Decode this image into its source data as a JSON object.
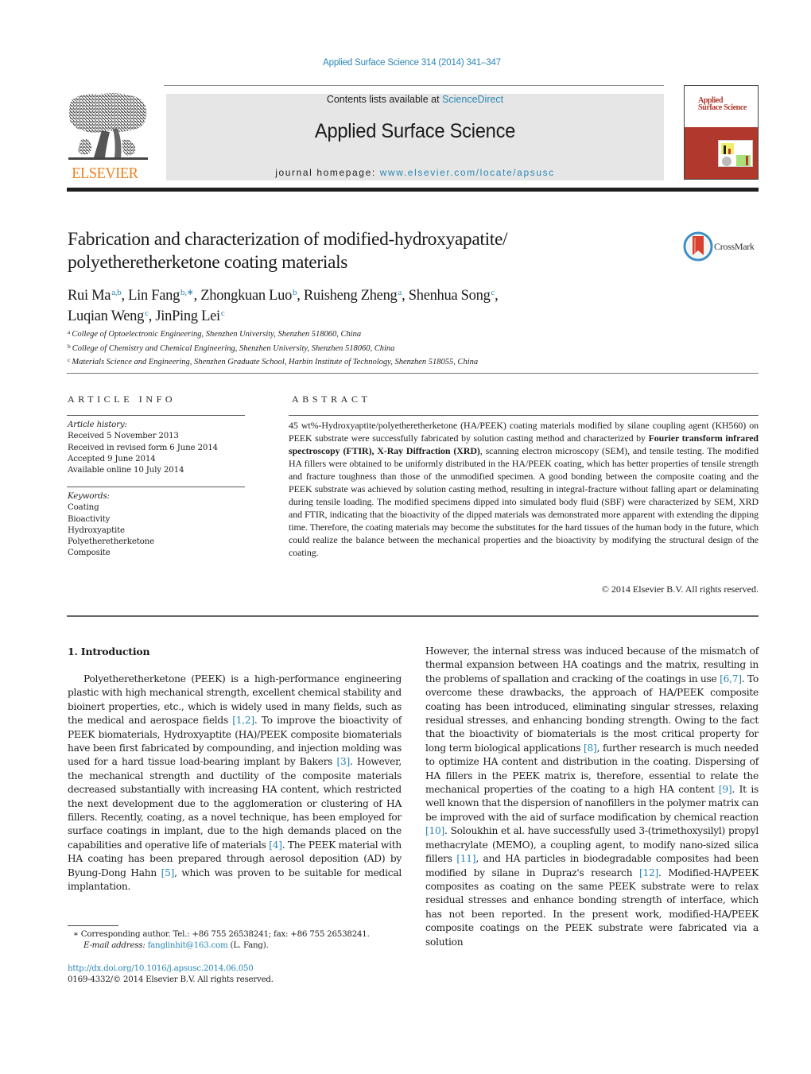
{
  "header": {
    "journal_ref": "Applied Surface Science 314 (2014) 341–347",
    "contents_prefix": "Contents lists available at ",
    "contents_link": "ScienceDirect",
    "journal_title": "Applied Surface Science",
    "homepage_prefix": "journal homepage: ",
    "homepage_link": "www.elsevier.com/locate/apsusc",
    "publisher_logo_text": "ELSEVIER",
    "publisher_logo_icon": "elsevier-tree-icon",
    "cover_title_line1": "Applied",
    "cover_title_line2": "Surface Science",
    "crossmark_label": "CrossMark",
    "crossmark_icon": "crossmark-icon"
  },
  "article": {
    "title": "Fabrication and characterization of modified-hydroxyapatite/ polyetheretherketone coating materials",
    "authors": [
      {
        "name": "Rui Ma",
        "sup": "a,b",
        "sep": ", "
      },
      {
        "name": "Lin Fang",
        "sup": "b,∗",
        "sep": ", "
      },
      {
        "name": "Zhongkuan Luo",
        "sup": "b",
        "sep": ", "
      },
      {
        "name": "Ruisheng Zheng",
        "sup": "a",
        "sep": ", "
      },
      {
        "name": "Shenhua Song",
        "sup": "c",
        "sep": ","
      },
      {
        "name": "Luqian Weng",
        "sup": "c",
        "sep": ", "
      },
      {
        "name": "JinPing Lei",
        "sup": "c",
        "sep": ""
      }
    ],
    "affiliations": [
      {
        "key": "a",
        "text": "College of Optoelectronic Engineering, Shenzhen University, Shenzhen 518060, China"
      },
      {
        "key": "b",
        "text": "College of Chemistry and Chemical Engineering, Shenzhen University, Shenzhen 518060, China"
      },
      {
        "key": "c",
        "text": "Materials Science and Engineering, Shenzhen Graduate School, Harbin Institute of Technology, Shenzhen 518055, China"
      }
    ]
  },
  "article_info": {
    "heading": "ARTICLE INFO",
    "history_label": "Article history:",
    "history": [
      "Received 5 November 2013",
      "Received in revised form 6 June 2014",
      "Accepted 9 June 2014",
      "Available online 10 July 2014"
    ],
    "keywords_label": "Keywords:",
    "keywords": [
      "Coating",
      "Bioactivity",
      "Hydroxyaptite",
      "Polyetheretherketone",
      "Composite"
    ]
  },
  "abstract": {
    "heading": "ABSTRACT",
    "part1": "45 wt%-Hydroxyaptite/polyetheretherketone (HA/PEEK) coating materials modified by silane coupling agent (KH560) on PEEK substrate were successfully fabricated by solution casting method and characterized by ",
    "bold1": "Fourier transform infrared spectroscopy (FTIR), X-Ray Diffraction (XRD)",
    "part2": ", scanning electron microscopy (SEM), and tensile testing. The modified HA fillers were obtained to be uniformly distributed in the HA/PEEK coating, which has better properties of tensile strength and fracture toughness than those of the unmodified specimen. A good bonding between the composite coating and the PEEK substrate was achieved by solution casting method, resulting in integral-fracture without falling apart or delaminating during tensile loading. The modified specimens dipped into simulated body fluid (SBF) were characterized by SEM, XRD and FTIR, indicating that the bioactivity of the dipped materials was demonstrated more apparent with extending the dipping time. Therefore, the coating materials may become the substitutes for the hard tissues of the human body in the future, which could realize the balance between the mechanical properties and the bioactivity by modifying the structural design of the coating.",
    "copyright": "© 2014 Elsevier B.V. All rights reserved."
  },
  "introduction": {
    "heading": "1.  Introduction",
    "left_segments": [
      {
        "t": "Polyetheretherketone (PEEK) is a high-performance engineering plastic with high mechanical strength, excellent chemical stability and bioinert properties, etc., which is widely used in many fields, such as the medical and aerospace fields "
      },
      {
        "ref": "[1,2]"
      },
      {
        "t": ". To improve the bioactivity of PEEK biomaterials, Hydroxyaptite (HA)/PEEK composite biomaterials have been first fabricated by compounding, and injection molding was used for a hard tissue load-bearing implant by Bakers "
      },
      {
        "ref": "[3]"
      },
      {
        "t": ". However, the mechanical strength and ductility of the composite materials decreased substantially with increasing HA content, which restricted the next development due to the agglomeration or clustering of HA fillers. Recently, coating, as a novel technique, has been employed for surface coatings in implant, due to the high demands placed on the capabilities and operative life of materials "
      },
      {
        "ref": "[4]"
      },
      {
        "t": ". The PEEK material with HA coating has been prepared through aerosol deposition (AD) by Byung-Dong Hahn "
      },
      {
        "ref": "[5]"
      },
      {
        "t": ", which was proven to be suitable for medical implantation."
      }
    ],
    "right_segments": [
      {
        "t": "However, the internal stress was induced because of the mismatch of thermal expansion between HA coatings and the matrix, resulting in the problems of spallation and cracking of the coatings in use "
      },
      {
        "ref": "[6,7]"
      },
      {
        "t": ". To overcome these drawbacks, the approach of HA/PEEK composite coating has been introduced, eliminating singular stresses, relaxing residual stresses, and enhancing bonding strength. Owing to the fact that the bioactivity of biomaterials is the most critical property for long term biological applications "
      },
      {
        "ref": "[8]"
      },
      {
        "t": ", further research is much needed to optimize HA content and distribution in the coating. Dispersing of HA fillers in the PEEK matrix is, therefore, essential to relate the mechanical properties of the coating to a high HA content "
      },
      {
        "ref": "[9]"
      },
      {
        "t": ". It is well known that the dispersion of nanofillers in the polymer matrix can be improved with the aid of surface modification by chemical reaction "
      },
      {
        "ref": "[10]"
      },
      {
        "t": ". Soloukhin et al. have successfully used 3-(trimethoxysilyl) propyl methacrylate (MEMO), a coupling agent, to modify nano-sized silica fillers "
      },
      {
        "ref": "[11]"
      },
      {
        "t": ", and HA particles in biodegradable composites had been modified by silane in Dupraz's research "
      },
      {
        "ref": "[12]"
      },
      {
        "t": ". Modified-HA/PEEK composites as coating on the same PEEK substrate were to relax residual stresses and enhance bonding strength of interface, which has not been reported. In the present work, modified-HA/PEEK composite coatings on the PEEK substrate were fabricated via a solution"
      }
    ]
  },
  "footnote": {
    "marker": "∗",
    "line1": " Corresponding author. Tel.: +86 755 26538241; fax: +86 755 26538241.",
    "email_label": "E-mail address: ",
    "email": "fanglinhit@163.com",
    "email_suffix": " (L. Fang)."
  },
  "doi": {
    "link": "http://dx.doi.org/10.1016/j.apsusc.2014.06.050",
    "issn_line": "0169-4332/© 2014 Elsevier B.V. All rights reserved."
  },
  "colors": {
    "link": "#2a86b5",
    "elsevier_orange": "#f07f1c",
    "cover_red": "#b0382c",
    "masthead_gray": "#e6e6e6"
  }
}
